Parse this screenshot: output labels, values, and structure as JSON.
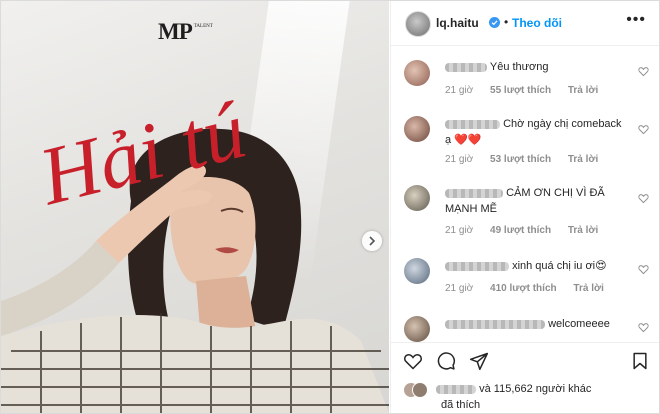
{
  "media": {
    "logo": "MP",
    "logo_small": "TALENT",
    "title_text": "Hải tú",
    "next_icon": "chevron-right-icon"
  },
  "header": {
    "username": "lq.haitu",
    "separator": "•",
    "follow_label": "Theo dõi",
    "more_label": "•••"
  },
  "comments": [
    {
      "text": "Yêu thương",
      "time": "21 giờ",
      "likes": "55 lượt thích",
      "reply": "Trả lời"
    },
    {
      "text": "Chờ ngày chị comeback ạ ❤️❤️",
      "time": "21 giờ",
      "likes": "53 lượt thích",
      "reply": "Trả lời"
    },
    {
      "text": "CẢM ƠN CHỊ VÌ ĐÃ MẠNH MẼ",
      "time": "21 giờ",
      "likes": "49 lượt thích",
      "reply": "Trả lời"
    },
    {
      "text": "xinh quá chị iu ơi😍",
      "time": "21 giờ",
      "likes": "410 lượt thích",
      "reply": "Trả lời"
    },
    {
      "text": "welcomeeee",
      "time": "",
      "likes": "",
      "reply": ""
    }
  ],
  "liked_by": {
    "text": "và 115,662 người khác",
    "text2": "đã thích"
  },
  "colors": {
    "accent": "#0095f6",
    "title_red": "#c8202b",
    "muted": "#8e8e8e"
  }
}
